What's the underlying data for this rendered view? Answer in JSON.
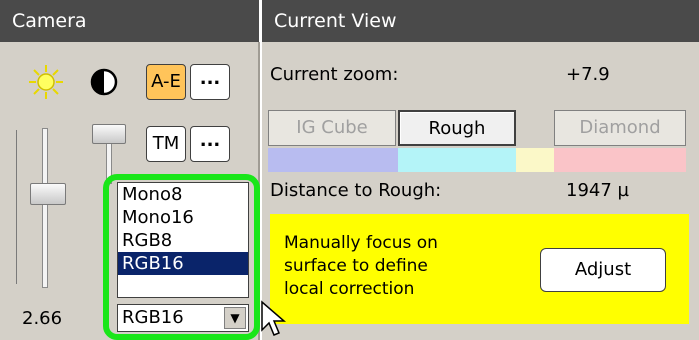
{
  "camera_panel": {
    "title": "Camera",
    "auto_exposure_label": "A-E",
    "auto_exposure_more_label": "...",
    "tone_map_label": "TM",
    "tone_map_more_label": "...",
    "exposure_value": "2.66",
    "pixel_format": {
      "options": [
        "Mono8",
        "Mono16",
        "RGB8",
        "RGB16"
      ],
      "selected": "RGB16"
    }
  },
  "view_panel": {
    "title": "Current View",
    "zoom_label": "Current zoom:",
    "zoom_value": "+7.9",
    "tabs": [
      {
        "label": "IG Cube",
        "enabled": false
      },
      {
        "label": "Rough",
        "enabled": true,
        "active": true
      },
      {
        "label": "Diamond",
        "enabled": false
      }
    ],
    "distance_label": "Distance to Rough:",
    "distance_value": "1947 µ",
    "focus_message": "Manually focus on\nsurface to define\nlocal correction",
    "adjust_label": "Adjust"
  },
  "colors": {
    "header_bg": "#4a4a4a",
    "panel_bg": "#d4d0c8",
    "highlight_green": "#19e619",
    "focus_panel_yellow": "#ffff00",
    "auto_exposure_orange": "#ffc45a",
    "selection_blue": "#0a246a"
  },
  "icons": {
    "brightness": "sun-icon",
    "contrast": "contrast-icon",
    "dropdown": "chevron-down-icon",
    "cursor": "mouse-pointer-icon"
  }
}
